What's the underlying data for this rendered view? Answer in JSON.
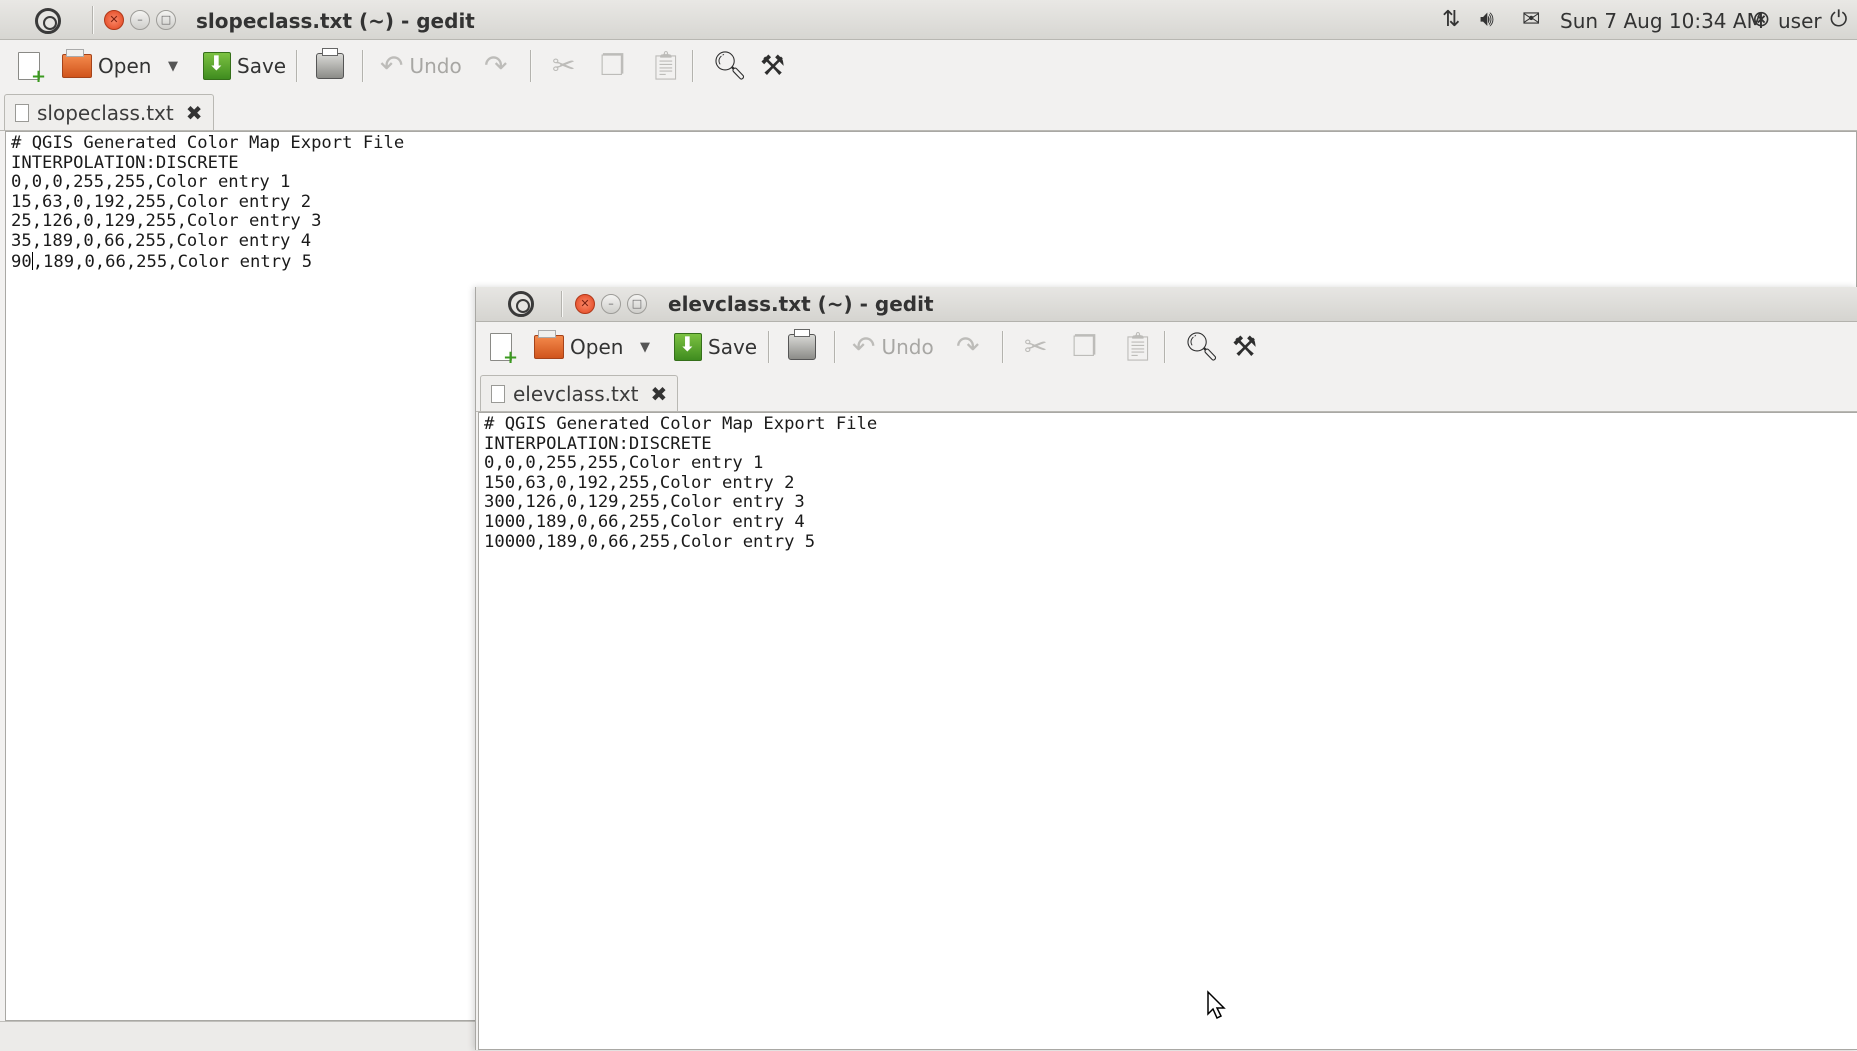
{
  "panel": {
    "active_title": "slopeclass.txt (~) - gedit",
    "clock": "Sun 7 Aug 10:34 AM",
    "user": "user"
  },
  "toolbar": {
    "new_icon": "new-document-icon",
    "open_label": "Open",
    "save_label": "Save",
    "undo_label": "Undo"
  },
  "window_back": {
    "title": "slopeclass.txt (~) - gedit",
    "tab_label": "slopeclass.txt",
    "lines": [
      "# QGIS Generated Color Map Export File",
      "INTERPOLATION:DISCRETE",
      "0,0,0,255,255,Color entry 1",
      "15,63,0,192,255,Color entry 2",
      "25,126,0,129,255,Color entry 3",
      "35,189,0,66,255,Color entry 4"
    ],
    "last_line_before_caret": "90",
    "last_line_after_caret": ",189,0,66,255,Color entry 5"
  },
  "window_front": {
    "title": "elevclass.txt (~) - gedit",
    "tab_label": "elevclass.txt",
    "lines": [
      "# QGIS Generated Color Map Export File",
      "INTERPOLATION:DISCRETE",
      "0,0,0,255,255,Color entry 1",
      "150,63,0,192,255,Color entry 2",
      "300,126,0,129,255,Color entry 3",
      "1000,189,0,66,255,Color entry 4",
      "10000,189,0,66,255,Color entry 5"
    ]
  },
  "colors": {
    "close_button": "#e0421c",
    "save_green": "#3f8c1f",
    "open_orange": "#d0541c"
  }
}
